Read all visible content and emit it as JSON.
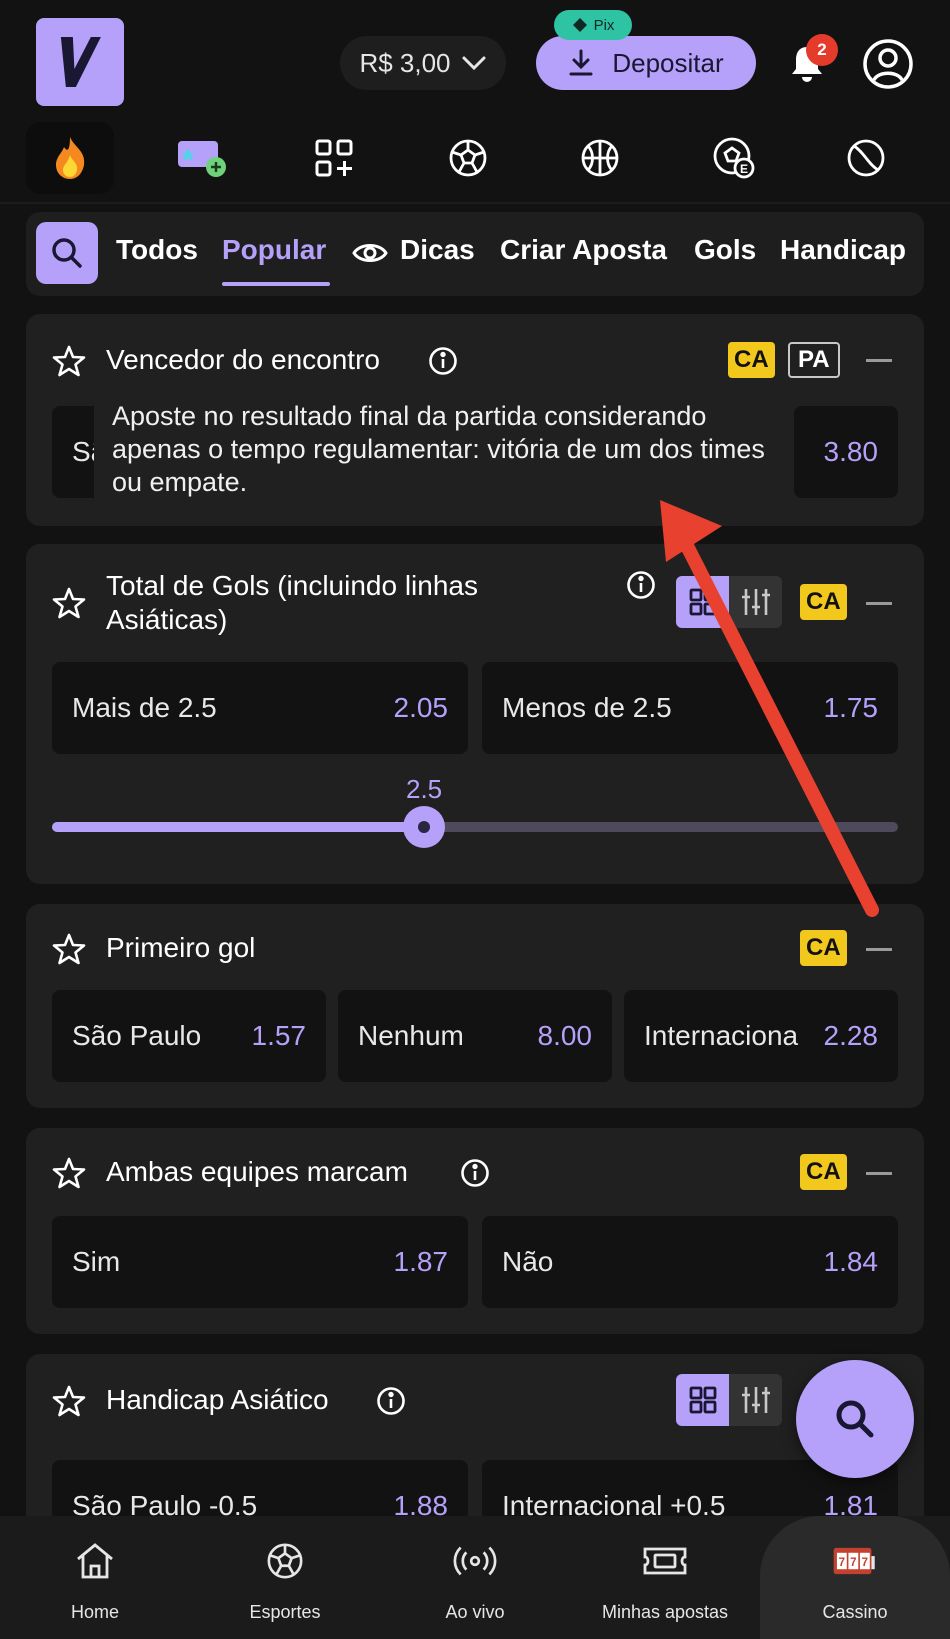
{
  "header": {
    "logo_letter": "V",
    "balance": "R$ 3,00",
    "deposit_label": "Depositar",
    "pix_label": "Pix",
    "notification_count": "2"
  },
  "sport_icons": [
    "fire-icon",
    "ticket-star-icon",
    "grid-plus-icon",
    "soccer-ball-icon",
    "basketball-icon",
    "esports-ball-icon",
    "tennis-ball-icon"
  ],
  "filters": {
    "tabs": [
      "Todos",
      "Popular",
      "Dicas",
      "Criar Aposta",
      "Gols",
      "Handicap"
    ],
    "active": "Popular"
  },
  "markets": {
    "vencedor": {
      "title": "Vencedor do encontro",
      "badge_ca": "CA",
      "badge_pa": "PA",
      "left_partial": "Sã",
      "odds_right": "3.80",
      "tooltip": "Aposte no resultado final da partida considerando apenas o tempo regulamentar: vitória de um dos times ou empate."
    },
    "total_gols": {
      "title_line1": "Total de Gols (incluindo linhas",
      "title_line2": "Asiáticas)",
      "badge_ca": "CA",
      "over_label": "Mais de 2.5",
      "over_odds": "2.05",
      "under_label": "Menos de 2.5",
      "under_odds": "1.75",
      "slider_value": "2.5",
      "slider_fraction": 0.44
    },
    "primeiro_gol": {
      "title": "Primeiro gol",
      "badge_ca": "CA",
      "options": [
        {
          "label": "São Paulo",
          "odds": "1.57"
        },
        {
          "label": "Nenhum",
          "odds": "8.00"
        },
        {
          "label": "Internacional",
          "odds": "2.28"
        }
      ]
    },
    "ambas": {
      "title": "Ambas equipes marcam",
      "badge_ca": "CA",
      "options": [
        {
          "label": "Sim",
          "odds": "1.87"
        },
        {
          "label": "Não",
          "odds": "1.84"
        }
      ]
    },
    "handicap": {
      "title": "Handicap Asiático",
      "options": [
        {
          "label": "São Paulo -0.5",
          "odds": "1.88"
        },
        {
          "label": "Internacional +0.5",
          "odds": "1.81"
        }
      ]
    }
  },
  "bottom_nav": [
    {
      "label": "Home",
      "icon": "home-icon"
    },
    {
      "label": "Esportes",
      "icon": "soccer-ball-icon"
    },
    {
      "label": "Ao vivo",
      "icon": "live-broadcast-icon"
    },
    {
      "label": "Minhas apostas",
      "icon": "ticket-icon"
    },
    {
      "label": "Cassino",
      "icon": "slot-machine-icon"
    }
  ],
  "colors": {
    "accent": "#b5a0fa",
    "background": "#121212",
    "card": "#202020",
    "badge_yellow": "#f2c81c",
    "arrow_red": "#e8412f",
    "pix_green": "#2ec3a3"
  }
}
